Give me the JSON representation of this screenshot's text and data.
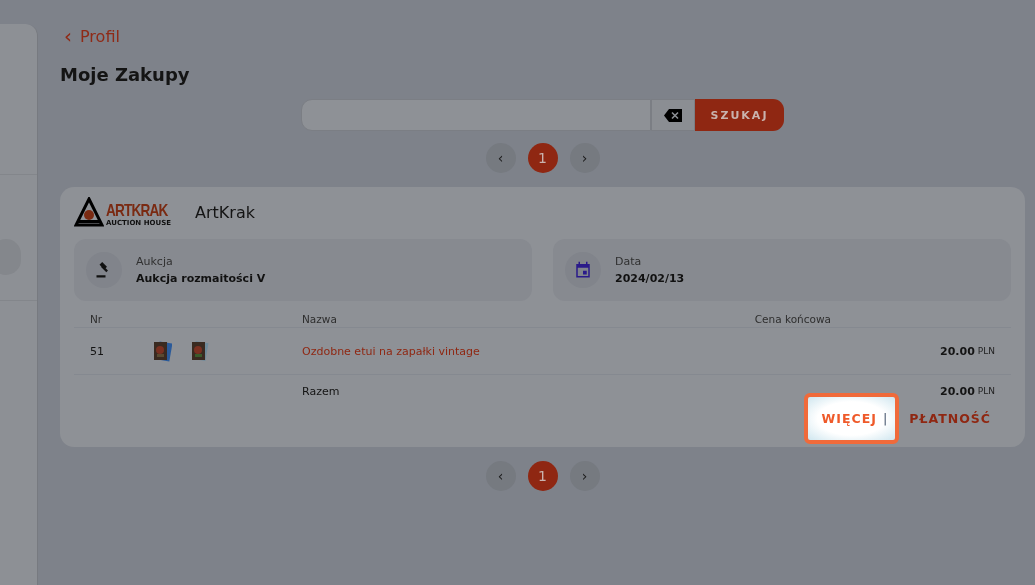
{
  "back_link": {
    "label": "Profil",
    "icon": "‹"
  },
  "title": "Moje Zakupy",
  "search": {
    "button": "SZUKAJ"
  },
  "pagination_top": {
    "prev": "‹",
    "next": "›",
    "pages": [
      {
        "label": "1",
        "selected": true
      }
    ]
  },
  "purchase": {
    "logo": {
      "wordmark": "ARTKRAK",
      "tagline": "AUCTION HOUSE"
    },
    "seller": "ArtKrak",
    "info": [
      {
        "kind": "auction",
        "label": "Aukcja",
        "value": "Aukcja rozmaitości V"
      },
      {
        "kind": "date",
        "label": "Data",
        "value": "2024/02/13"
      }
    ],
    "columns": [
      "Nr",
      "Nazwa",
      "Cena końcowa"
    ],
    "rows": [
      {
        "nr": "51",
        "name": "Ozdobne etui na zapałki vintage",
        "amount": "20.00",
        "currency": "PLN"
      }
    ],
    "total": {
      "label": "Razem",
      "amount": "20.00",
      "currency": "PLN"
    },
    "actions": [
      {
        "label": "WIĘCEJ",
        "highlighted": true
      },
      {
        "label": "PŁATNOŚĆ",
        "highlighted": false
      }
    ],
    "separator": "|"
  },
  "pagination_bottom": {
    "prev": "‹",
    "next": "›",
    "pages": [
      {
        "label": "1",
        "selected": true
      }
    ]
  }
}
